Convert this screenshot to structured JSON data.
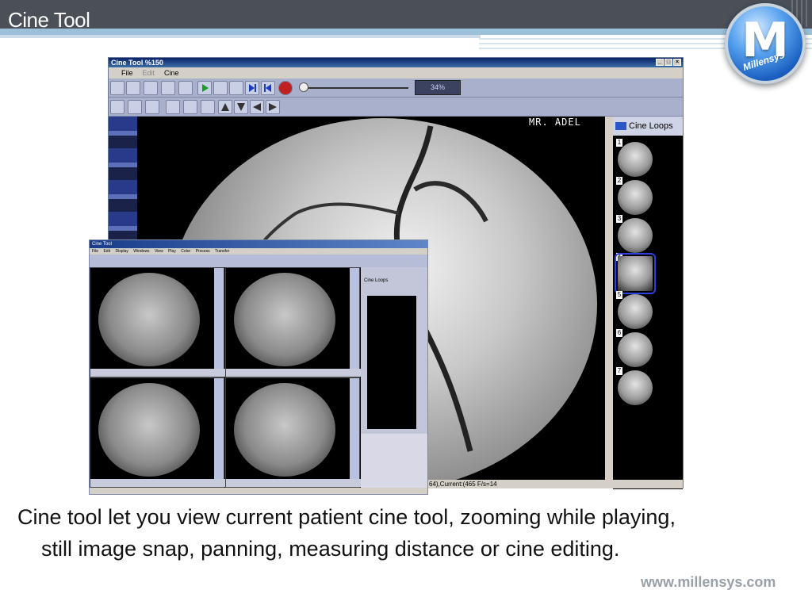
{
  "slide": {
    "title": "Cine Tool",
    "caption_line1": "Cine tool let you view current patient cine tool, zooming while playing,",
    "caption_line2": "still image snap, panning, measuring distance or cine editing.",
    "website": "www.millensys.com",
    "logo_text": "Millensys",
    "logo_letter": "M"
  },
  "main_window": {
    "title": "Cine Tool %150",
    "menu": [
      "File",
      "Edit",
      "Cine"
    ],
    "zoom_pct": "34%",
    "patient_name": "MR. ADEL",
    "cine_loops_label": "Cine Loops",
    "thumbnails": [
      "1",
      "2",
      "3",
      "4",
      "5",
      "6",
      "7"
    ],
    "selected_thumbnail": "4",
    "status_text": "64),Current:(465 F/s=14"
  },
  "inset_window": {
    "title": "Cine Tool",
    "menu": [
      "File",
      "Edit",
      "Display",
      "Windows",
      "View",
      "Play",
      "Color",
      "Process",
      "Transfer"
    ],
    "panel_tab": "Cine Loops"
  },
  "colors": {
    "header_dark": "#4a4f58",
    "header_stripe": "#9cc0d8",
    "toolbar_bg": "#a8b0cc",
    "selection_border": "#2b40e0"
  }
}
